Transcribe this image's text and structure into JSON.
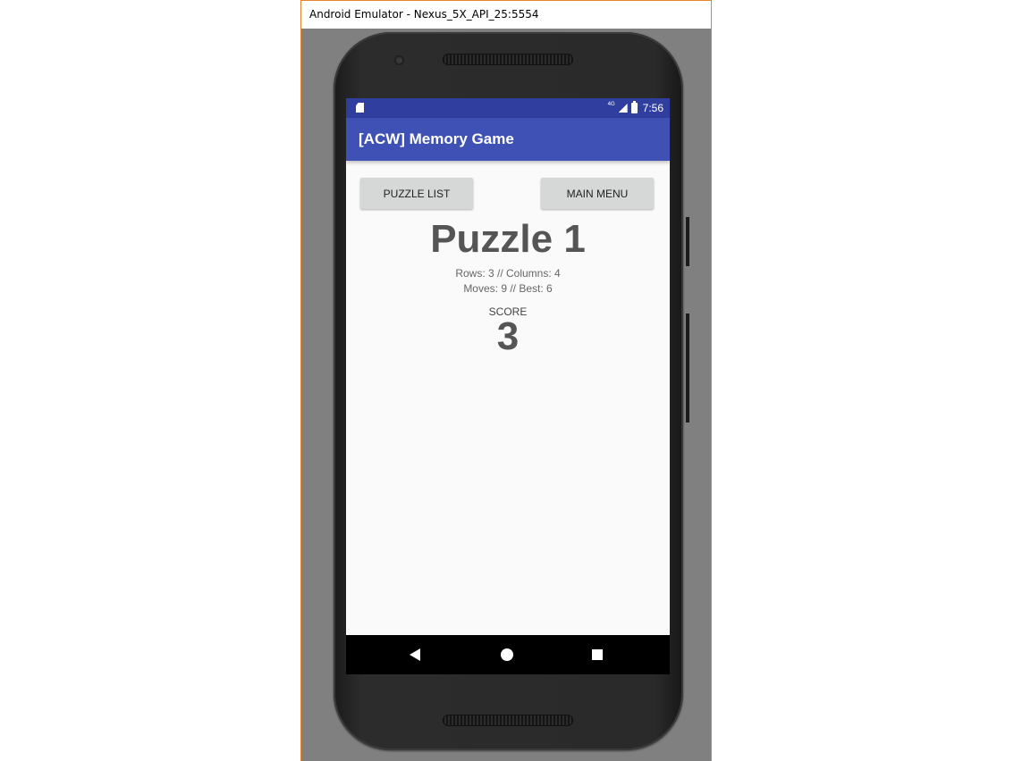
{
  "window": {
    "title": "Android Emulator - Nexus_5X_API_25:5554"
  },
  "status_bar": {
    "network": "4G",
    "time": "7:56"
  },
  "app_bar": {
    "title": "[ACW] Memory Game"
  },
  "buttons": {
    "puzzle_list": "PUZZLE LIST",
    "main_menu": "MAIN MENU"
  },
  "puzzle": {
    "title": "Puzzle 1",
    "dimensions": "Rows: 3 // Columns: 4",
    "moves": "Moves: 9 // Best: 6",
    "score_label": "SCORE",
    "score_value": "3"
  },
  "icons": {
    "status_left": "sd-card-icon",
    "signal": "signal-icon",
    "battery": "battery-icon",
    "nav_back": "back-icon",
    "nav_home": "home-icon",
    "nav_recents": "recents-icon"
  }
}
